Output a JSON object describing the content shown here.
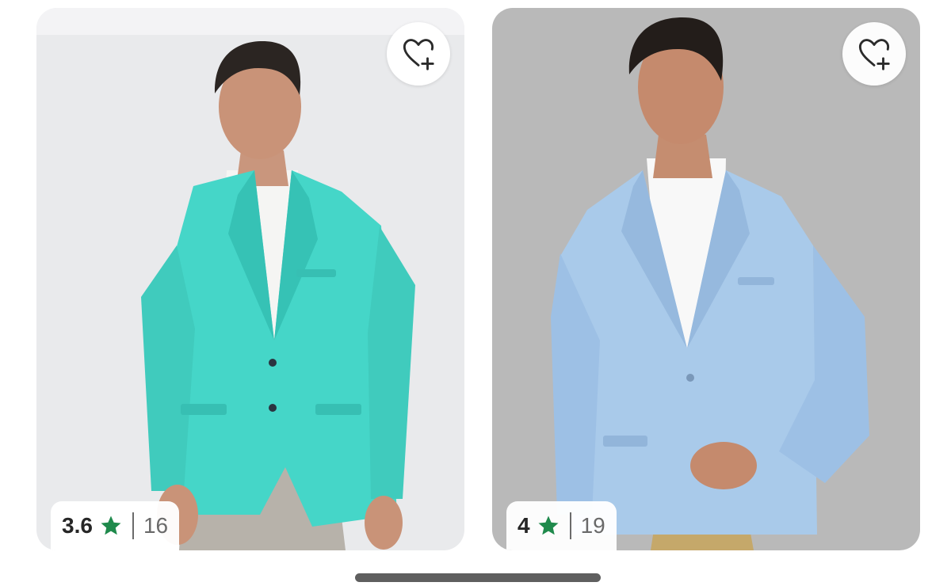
{
  "products": [
    {
      "rating": "3.6",
      "review_count": "16",
      "image_label": "teal-blazer-model-photo",
      "wishlist_icon": "heart-plus-icon",
      "rating_icon": "star-icon",
      "star_color": "#1f8a4c"
    },
    {
      "rating": "4",
      "review_count": "19",
      "image_label": "light-blue-blazer-model-photo",
      "wishlist_icon": "heart-plus-icon",
      "rating_icon": "star-icon",
      "star_color": "#1f8a4c"
    }
  ],
  "colors": {
    "teal_blazer": "#45d6c8",
    "light_blue_blazer": "#a9caea",
    "left_background": "#e9eaec",
    "right_background": "#b9b9b9"
  }
}
